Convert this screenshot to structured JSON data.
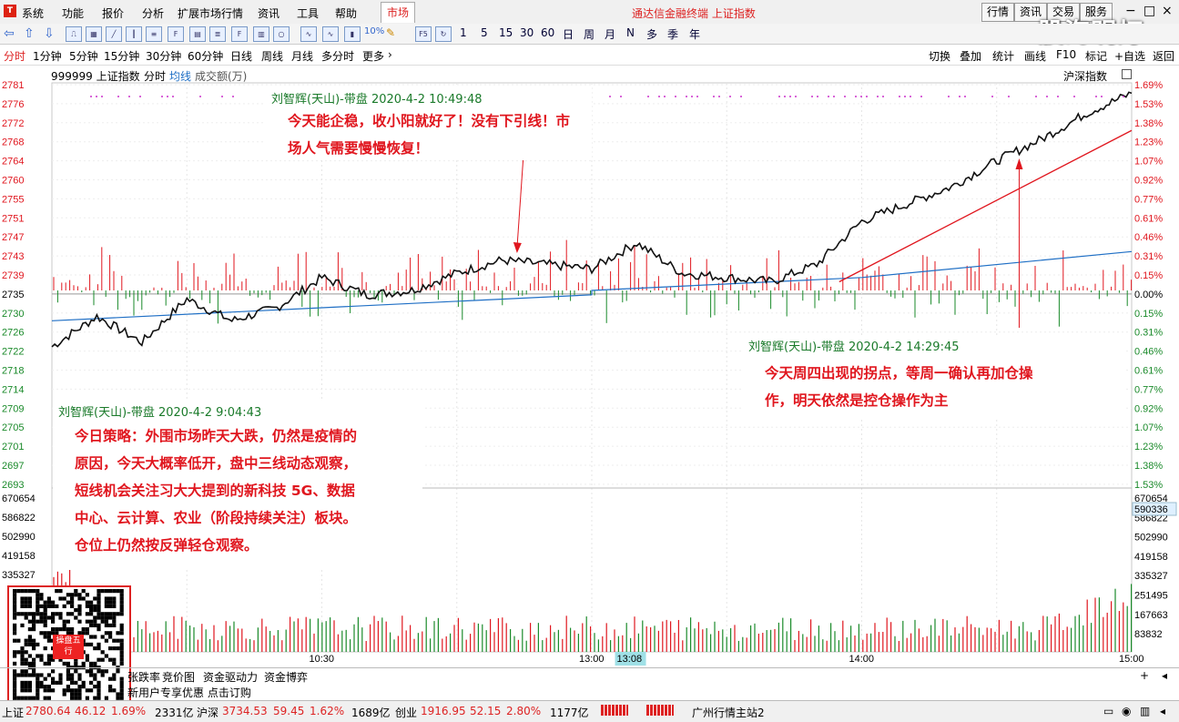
{
  "menu": {
    "items": [
      "系统",
      "功能",
      "报价",
      "分析",
      "扩展市场行情",
      "资讯",
      "工具",
      "帮助"
    ],
    "active_tab": "市场",
    "app_title": "通达信金融终端 上证指数",
    "right_buttons": [
      "行情",
      "资讯",
      "交易",
      "服务"
    ]
  },
  "watermark": "股海明灯",
  "toolbar": {
    "numbers": [
      "1",
      "5",
      "15",
      "30",
      "60",
      "日",
      "周",
      "月",
      "N",
      "多",
      "季",
      "年"
    ],
    "pct_label": "10%"
  },
  "periods": {
    "items": [
      "分时",
      "1分钟",
      "5分钟",
      "15分钟",
      "30分钟",
      "60分钟",
      "日线",
      "周线",
      "月线",
      "多分时",
      "更多"
    ],
    "active": "分时",
    "right": [
      "切换",
      "叠加",
      "统计",
      "画线",
      "F10",
      "标记",
      "+自选",
      "返回"
    ]
  },
  "info": {
    "code_name": "999999 上证指数",
    "label1": "分时",
    "label2": "均线",
    "label3": "成交额(万)",
    "right_label": "沪深指数"
  },
  "axes": {
    "price_ticks": [
      "2781",
      "2776",
      "2772",
      "2768",
      "2764",
      "2760",
      "2755",
      "2751",
      "2747",
      "2743",
      "2739",
      "2735",
      "2730",
      "2726",
      "2722",
      "2718",
      "2714",
      "2709",
      "2705",
      "2701",
      "2697",
      "2693"
    ],
    "pct_ticks": [
      "1.69%",
      "1.53%",
      "1.38%",
      "1.23%",
      "1.07%",
      "0.92%",
      "0.77%",
      "0.61%",
      "0.46%",
      "0.31%",
      "0.15%",
      "0.00%",
      "0.15%",
      "0.31%",
      "0.46%",
      "0.61%",
      "0.77%",
      "0.92%",
      "1.07%",
      "1.23%",
      "1.38%",
      "1.53%"
    ],
    "vol_left_ticks": [
      "670654",
      "586822",
      "502990",
      "419158",
      "335327"
    ],
    "vol_right_ticks": [
      "670654",
      "586822",
      "502990",
      "419158",
      "335327",
      "251495",
      "167663",
      "83832"
    ],
    "vol_highlight": "590336",
    "time_ticks": [
      "10:30",
      "13:00",
      "14:00",
      "15:00"
    ],
    "cursor_time": "13:08"
  },
  "chart_data": {
    "type": "line",
    "prev_close": 2735,
    "ylim": [
      2689,
      2783
    ],
    "x_range": [
      "09:30",
      "15:00"
    ],
    "series": [
      {
        "x": [
          "09:30",
          "09:40",
          "09:50",
          "10:00",
          "10:10",
          "10:20",
          "10:30",
          "10:40",
          "10:50",
          "11:00",
          "11:10",
          "11:20",
          "11:30",
          "13:10",
          "13:20",
          "13:30",
          "13:40",
          "13:50",
          "14:00",
          "14:10",
          "14:20",
          "14:30",
          "14:40",
          "14:50",
          "15:00"
        ],
        "values": [
          2722,
          2729,
          2723,
          2733,
          2728,
          2731,
          2738,
          2734,
          2735,
          2739,
          2742,
          2741,
          2740,
          2746,
          2739,
          2738,
          2737,
          2741,
          2751,
          2755,
          2759,
          2765,
          2770,
          2776,
          2780.6
        ]
      },
      {
        "x": [
          "09:30",
          "10:30",
          "11:30",
          "13:00",
          "14:00",
          "15:00"
        ],
        "values": [
          2728,
          2731,
          2734,
          2735,
          2738,
          2744
        ]
      }
    ],
    "volume_ticks_left": [
      "670654",
      "586822",
      "502990",
      "419158",
      "335327"
    ]
  },
  "notes": [
    {
      "head": "刘智辉(天山)-带盘 2020-4-2 10:49:48",
      "lines": [
        "今天能企稳，收小阳就好了！没有下引线！市",
        "场人气需要慢慢恢复！"
      ]
    },
    {
      "head": "刘智辉(天山)-带盘 2020-4-2 14:29:45",
      "lines": [
        "今天周四出现的拐点，等周一确认再加仓操",
        "作，明天依然是控仓操作为主"
      ]
    },
    {
      "head": "刘智辉(天山)-带盘 2020-4-2 9:04:43",
      "lines": [
        "今日策略：外围市场昨天大跌，仍然是疫情的",
        "原因，今天大概率低开，盘中三线动态观察，",
        "短线机会关注习大大提到的新科技 5G、数据",
        "中心、云计算、农业（阶段持续关注）板块。",
        "仓位上仍然按反弹轻仓观察。"
      ]
    }
  ],
  "qr_label": "操盘五行",
  "bottom_tabs": [
    "张跌率",
    "竞价图",
    "资金驱动力",
    "资金博弈"
  ],
  "promo": "新用户专享优惠 点击订购",
  "status": {
    "sh_label": "上证",
    "sh_value": "2780.64",
    "sh_change": "46.12",
    "sh_pct": "1.69%",
    "sh_amount": "2331亿",
    "hs_label": "沪深",
    "hs_value": "3734.53",
    "hs_change": "59.45",
    "hs_pct": "1.62%",
    "hs_amount": "1689亿",
    "cy_label": "创业",
    "cy_value": "1916.95",
    "cy_change": "52.15",
    "cy_pct": "2.80%",
    "cy_amount": "1177亿",
    "server": "广州行情主站2"
  },
  "colors": {
    "up": "#e0161e",
    "down": "#1a8a2a",
    "price_line": "#111111",
    "avg_line": "#1f6fc5"
  }
}
